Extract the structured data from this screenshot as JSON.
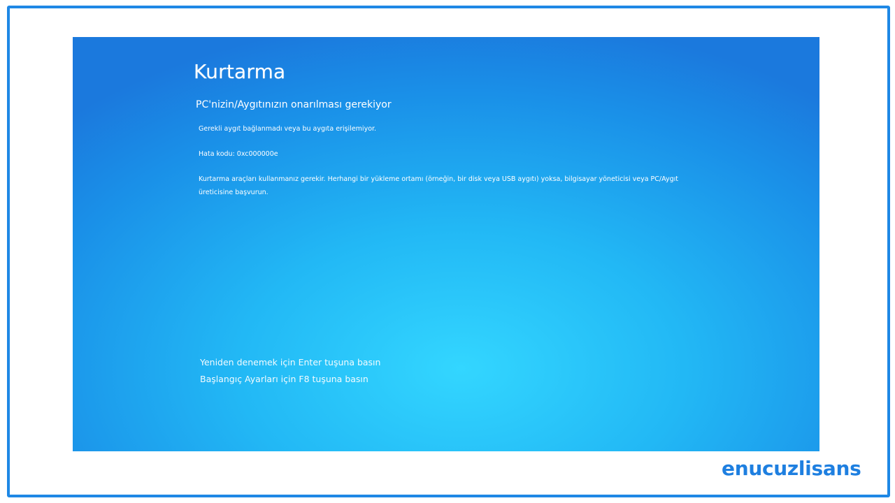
{
  "screen": {
    "title": "Kurtarma",
    "subtitle": "PC'nizin/Aygıtınızın onarılması gerekiyor",
    "message": "Gerekli aygıt bağlanmadı veya bu aygıta erişilemiyor.",
    "error_code": "Hata kodu: 0xc000000e",
    "instructions": "Kurtarma araçları kullanmanız gerekir. Herhangi bir yükleme ortamı (örneğin, bir disk veya USB aygıtı) yoksa, bilgisayar yöneticisi veya PC/Aygıt üreticisine başvurun.",
    "action_enter": "Yeniden denemek için Enter tuşuna basın",
    "action_f8": "Başlangıç Ayarları için F8 tuşuna basın"
  },
  "brand": {
    "watermark": "enucuzlisans"
  },
  "colors": {
    "frame_border": "#1e88e5",
    "screen_blue_top": "#1b79dd",
    "screen_blue_center": "#33d6ff",
    "brand": "#1e7fe0"
  }
}
